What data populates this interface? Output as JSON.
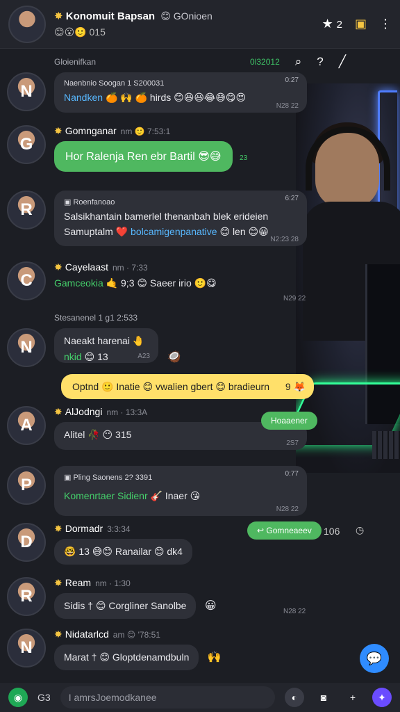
{
  "header": {
    "title": "Konomuit Bapsan",
    "subtitle": "GOnioen",
    "emoji_line": "😊😮🙂 015",
    "actions": {
      "star_count": "2"
    }
  },
  "subbar": {
    "label": "Gloienifkan",
    "status": "0l32012"
  },
  "messages": [
    {
      "avatar": "N",
      "name_line": "Naenbnio Soogan 1 S200031",
      "time_top": "0:27",
      "text_blue": "Nandken",
      "text_rest": "🍊 🙌 🍊 hirds 😊😆😃😂😅😋😍",
      "time": "N28 22"
    },
    {
      "avatar": "G",
      "name": "Gomnganar",
      "meta": "nm 🙂 7:53:1",
      "text": "Hor Ralenja Ren ebr Bartil 😎😅",
      "time": "23"
    },
    {
      "avatar": "R",
      "name": "Roenfanoao",
      "time_top": "6:27",
      "line1": "Salsikhantain bamerlel thenanbah blek erideien",
      "line2_a": "Samuptalm ❤️",
      "line2_blue": "bolcamigenpanative",
      "line2_b": "😊 len 😊😀",
      "time": "N2:23 28"
    },
    {
      "avatar": "C",
      "name": "Cayelaast",
      "meta": "nm · 7:33",
      "text_green": "Gamceokia",
      "text_rest": "🤙 9;3 😊 Saeer irio 🙂😋",
      "time": "N29 22"
    },
    {
      "sys": "Stesanenel 1 g1 2:533",
      "avatar": "N",
      "line1": "Naeakt harenai 🤚",
      "line2_green": "nkid",
      "line2_rest": "😊 13",
      "time": "A23",
      "tail": "🥥"
    },
    {
      "yellow_text": "Optnd 🙂 Inatie 😊 vwalien gbert 😊 bradieurn",
      "yellow_end": "9 🦊"
    },
    {
      "avatar": "A",
      "name": "AlJodngi",
      "meta": "nm · 13:3A",
      "chip": "Hoaaener",
      "text": "Alitel 🥀 😶 315",
      "time": "2S7"
    },
    {
      "avatar": "P",
      "name": "Pling Saonens",
      "meta": "2? 3391",
      "time_top": "0:77",
      "text_green": "Komenrtaer Sidienr",
      "text_rest": "🎸 Inaer 😘",
      "time": "N28 22"
    },
    {
      "avatar": "D",
      "name": "Dormadr",
      "meta": "3:3:34",
      "chip": "Gomneaeev",
      "chip_time": "106",
      "text": "🤓 13 😅😊 Ranailar 😊 dk4"
    },
    {
      "avatar": "R",
      "name": "Ream",
      "meta": "nm · 1:30",
      "text": "Sidis † 😊 Corgliner Sanolbe",
      "tail": "😀",
      "time": "N28 22"
    },
    {
      "avatar": "N",
      "name": "Nidatarlcd",
      "meta": "am 😊 '78:51",
      "text": "Marat † 😊 Gloptdenamdbuln",
      "tail": "🙌"
    }
  ],
  "composer": {
    "label_left": "G3",
    "placeholder": "I amrsJoemodkanee"
  },
  "colors": {
    "accent_green": "#4fb860",
    "accent_yellow": "#ffe06a",
    "accent_blue": "#2f8cff",
    "bubble": "#2e3038",
    "background": "#1c1e24"
  },
  "icons": {
    "header": [
      "star-icon",
      "notification-icon",
      "more-icon"
    ],
    "subbar": [
      "search-icon",
      "help-icon",
      "edit-icon"
    ],
    "composer": [
      "whatsapp-icon",
      "emoji-icon",
      "camera-icon",
      "plus-icon",
      "sparkle-icon"
    ],
    "fab": "chat-bubble-icon"
  }
}
